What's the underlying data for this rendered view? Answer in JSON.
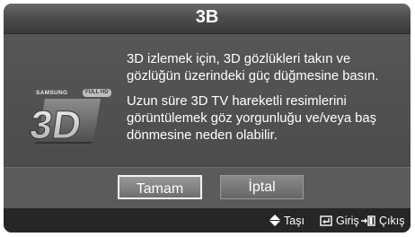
{
  "dialog": {
    "title": "3B",
    "logo": {
      "brand": "SAMSUNG",
      "badge": "FULL HD",
      "mark": "3D"
    },
    "messages": [
      "3D izlemek için, 3D gözlükleri takın ve gözlüğün üzerindeki güç düğmesine basın.",
      "Uzun süre 3D TV hareketli resimlerini görüntülemek göz yorgunluğu ve/veya baş dönmesine neden olabilir."
    ],
    "buttons": {
      "ok_label": "Tamam",
      "cancel_label": "İptal",
      "selected": "Tamam"
    },
    "footer": {
      "move": {
        "icon": "up-down-arrows-icon",
        "label": "Taşı"
      },
      "enter": {
        "icon": "enter-icon",
        "label": "Giriş"
      },
      "exit": {
        "icon": "exit-icon",
        "label": "Çıkış"
      }
    }
  },
  "colors": {
    "panel": "#4a4a4a",
    "footer": "#262626",
    "text": "#ffffff",
    "focus_border": "#f2f2f2"
  }
}
